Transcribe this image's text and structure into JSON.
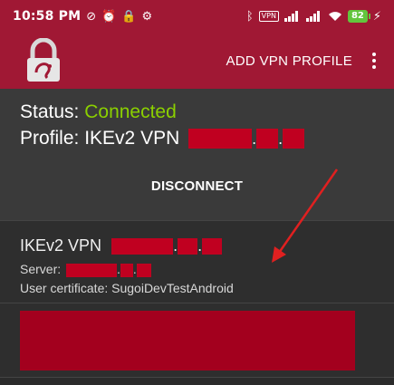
{
  "statusbar": {
    "time": "10:58 PM",
    "vpn_badge": "VPN",
    "battery": "82"
  },
  "appbar": {
    "add_profile_label": "ADD VPN PROFILE"
  },
  "status_panel": {
    "status_label": "Status:",
    "status_value": "Connected",
    "profile_label": "Profile:",
    "profile_name": "IKEv2 VPN",
    "disconnect_label": "DISCONNECT"
  },
  "profile_item": {
    "title": "IKEv2 VPN",
    "server_label": "Server:",
    "certificate_text": "User certificate: SugoiDevTestAndroid"
  },
  "colors": {
    "brand": "#a01834",
    "connected": "#8bd000",
    "redaction": "#c00020",
    "annotation_arrow": "#e02020"
  }
}
